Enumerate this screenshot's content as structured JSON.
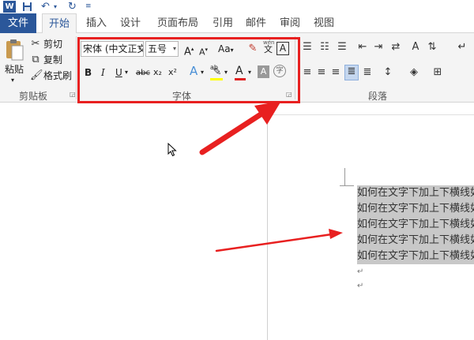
{
  "titlebar": {
    "app_icon": "W",
    "save_icon": "save-icon",
    "undo_icon": "undo-icon",
    "redo_icon": "redo-icon"
  },
  "tabs": [
    {
      "label": "文件"
    },
    {
      "label": "开始"
    },
    {
      "label": "插入"
    },
    {
      "label": "设计"
    },
    {
      "label": "页面布局"
    },
    {
      "label": "引用"
    },
    {
      "label": "邮件"
    },
    {
      "label": "审阅"
    },
    {
      "label": "视图"
    }
  ],
  "clipboard": {
    "paste_label": "粘贴",
    "cut_label": "剪切",
    "copy_label": "复制",
    "format_painter_label": "格式刷",
    "group_label": "剪贴板"
  },
  "font": {
    "font_name": "宋体 (中文正文",
    "font_size": "五号",
    "group_label": "字体",
    "grow_glyph": "A",
    "shrink_glyph": "A",
    "case_glyph": "Aa",
    "bold": "B",
    "italic": "I",
    "underline": "U",
    "strike": "abc",
    "subscript": "x₂",
    "superscript": "x²",
    "effects_glyph": "A",
    "font_color_glyph": "A",
    "shading_glyph": "A",
    "border_glyph": "A",
    "phonetic_glyph": "文",
    "phonetic_top": "wén",
    "enclose_glyph": "字",
    "highlight_top": "ab"
  },
  "paragraph": {
    "group_label": "段落"
  },
  "document": {
    "lines": [
      "如何在文字下加上下横线如何",
      "如何在文字下加上下横线如何",
      "如何在文字下加上下横线如何",
      "如何在文字下加上下横线如何",
      "如何在文字下加上下横线如何"
    ],
    "para_mark": "↵"
  },
  "colors": {
    "accent": "#2b579a",
    "highlight_box": "#e82020",
    "arrow": "#e82020",
    "selection": "#c8c8c8"
  }
}
